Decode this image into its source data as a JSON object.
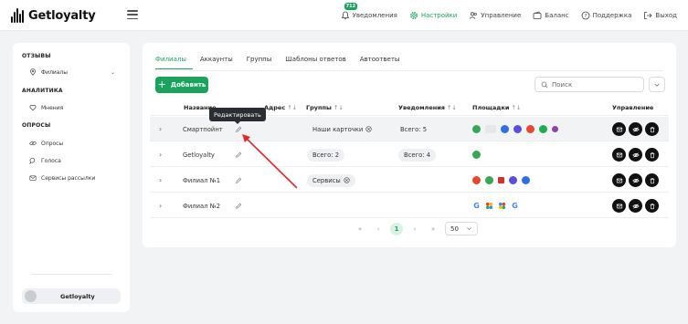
{
  "app": {
    "logo_text": "Getloyalty"
  },
  "topnav": {
    "notifications": {
      "label": "Уведомления",
      "badge": "712"
    },
    "settings": {
      "label": "Настройки"
    },
    "management": {
      "label": "Управление"
    },
    "balance": {
      "label": "Баланс"
    },
    "support": {
      "label": "Поддержка"
    },
    "logout": {
      "label": "Выход"
    }
  },
  "sidebar": {
    "sections": [
      {
        "title": "ОТЗЫВЫ"
      },
      {
        "title": "АНАЛИТИКА"
      },
      {
        "title": "ОПРОСЫ"
      }
    ],
    "items": [
      {
        "label": "Филиалы"
      },
      {
        "label": "Мнения"
      },
      {
        "label": "Опросы"
      },
      {
        "label": "Голоса"
      },
      {
        "label": "Сервисы рассылки"
      }
    ],
    "user": {
      "name": "Getloyalty"
    }
  },
  "tabs": [
    {
      "label": "Филиалы"
    },
    {
      "label": "Аккаунты"
    },
    {
      "label": "Группы"
    },
    {
      "label": "Шаблоны ответов"
    },
    {
      "label": "Автоответы"
    }
  ],
  "toolbar": {
    "add_label": "Добавить",
    "search_placeholder": "Поиск"
  },
  "table": {
    "headers": {
      "name": "Название",
      "address": "Адрес",
      "groups": "Группы",
      "notifications": "Уведомления",
      "platforms": "Площадки",
      "actions": "Управление"
    },
    "sort_glyph": "↑↓",
    "rows": [
      {
        "name": "Смартпойнт",
        "group": "Наши карточки",
        "notifications": "Всего: 5"
      },
      {
        "name": "Getloyalty",
        "group": "Всего: 2",
        "notifications": "Всего: 4"
      },
      {
        "name": "Филиал №1",
        "group": "Сервисы",
        "notifications": ""
      },
      {
        "name": "Филиал №2",
        "group": "",
        "notifications": ""
      }
    ]
  },
  "tooltip": {
    "text": "Редактировать"
  },
  "pagination": {
    "first": "«",
    "prev": "‹",
    "current": "1",
    "next": "›",
    "last": "»",
    "per_page": "50"
  },
  "colors": {
    "accent": "#1aa35c",
    "dark": "#111111",
    "arrow": "#e02b2b"
  }
}
